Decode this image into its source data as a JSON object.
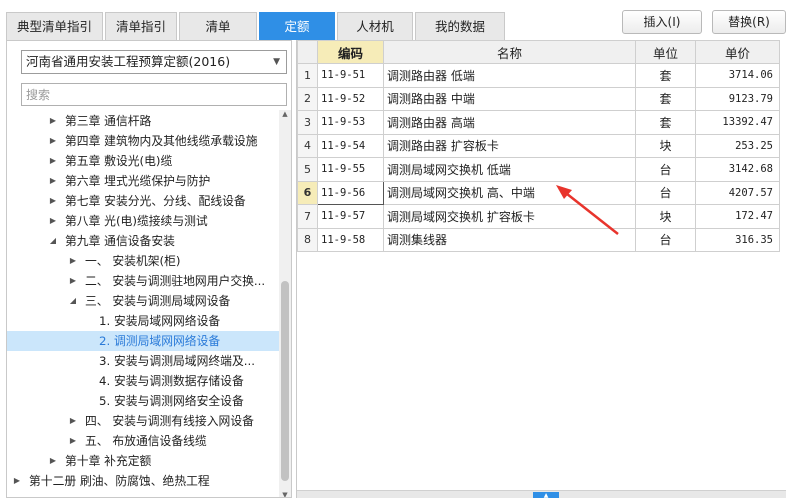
{
  "tabs": [
    "典型清单指引",
    "清单指引",
    "清单",
    "定额",
    "人材机",
    "我的数据"
  ],
  "active_tab": 3,
  "buttons": {
    "insert": "插入(I)",
    "replace": "替换(R)"
  },
  "library": {
    "selected": "河南省通用安装工程预算定额(2016)"
  },
  "search": {
    "placeholder": "搜索"
  },
  "tree": [
    {
      "label": "第三章 通信杆路",
      "level": 1,
      "expander": "collapsed"
    },
    {
      "label": "第四章 建筑物内及其他线缆承载设施",
      "level": 1,
      "expander": "collapsed"
    },
    {
      "label": "第五章 敷设光(电)缆",
      "level": 1,
      "expander": "collapsed"
    },
    {
      "label": "第六章 埋式光缆保护与防护",
      "level": 1,
      "expander": "collapsed"
    },
    {
      "label": "第七章 安装分光、分线、配线设备",
      "level": 1,
      "expander": "collapsed"
    },
    {
      "label": "第八章 光(电)缆接续与测试",
      "level": 1,
      "expander": "collapsed"
    },
    {
      "label": "第九章 通信设备安装",
      "level": 1,
      "expander": "expanded"
    },
    {
      "label": "一、 安装机架(柜)",
      "level": 2,
      "expander": "collapsed"
    },
    {
      "label": "二、 安装与调测驻地网用户交换...",
      "level": 2,
      "expander": "collapsed"
    },
    {
      "label": "三、 安装与调测局域网设备",
      "level": 2,
      "expander": "expanded"
    },
    {
      "label": "1. 安装局域网网络设备",
      "level": 3,
      "expander": "none"
    },
    {
      "label": "2. 调测局域网网络设备",
      "level": 3,
      "expander": "none",
      "selected": true
    },
    {
      "label": "3. 安装与调测局域网终端及...",
      "level": 3,
      "expander": "none"
    },
    {
      "label": "4. 安装与调测数据存储设备",
      "level": 3,
      "expander": "none"
    },
    {
      "label": "5. 安装与调测网络安全设备",
      "level": 3,
      "expander": "none"
    },
    {
      "label": "四、 安装与调测有线接入网设备",
      "level": 2,
      "expander": "collapsed"
    },
    {
      "label": "五、 布放通信设备线缆",
      "level": 2,
      "expander": "collapsed"
    },
    {
      "label": "第十章 补充定额",
      "level": 1,
      "expander": "collapsed"
    },
    {
      "label": "第十二册 刷油、防腐蚀、绝热工程",
      "level": 0,
      "expander": "collapsed"
    }
  ],
  "grid": {
    "headers": {
      "code": "编码",
      "name": "名称",
      "unit": "单位",
      "price": "单价"
    },
    "rows": [
      {
        "idx": "1",
        "code": "11-9-51",
        "name": "调测路由器 低端",
        "unit": "套",
        "price": "3714.06"
      },
      {
        "idx": "2",
        "code": "11-9-52",
        "name": "调测路由器 中端",
        "unit": "套",
        "price": "9123.79"
      },
      {
        "idx": "3",
        "code": "11-9-53",
        "name": "调测路由器 高端",
        "unit": "套",
        "price": "13392.47"
      },
      {
        "idx": "4",
        "code": "11-9-54",
        "name": "调测路由器 扩容板卡",
        "unit": "块",
        "price": "253.25"
      },
      {
        "idx": "5",
        "code": "11-9-55",
        "name": "调测局域网交换机 低端",
        "unit": "台",
        "price": "3142.68"
      },
      {
        "idx": "6",
        "code": "11-9-56",
        "name": "调测局域网交换机 高、中端",
        "unit": "台",
        "price": "4207.57"
      },
      {
        "idx": "7",
        "code": "11-9-57",
        "name": "调测局域网交换机 扩容板卡",
        "unit": "块",
        "price": "172.47"
      },
      {
        "idx": "8",
        "code": "11-9-58",
        "name": "调测集线器",
        "unit": "台",
        "price": "316.35"
      }
    ],
    "current_row": 5
  },
  "colors": {
    "accent": "#2f8fe6",
    "selection": "#cbe6fb",
    "header_highlight": "#f6ecb8",
    "annotation": "#e8342c"
  }
}
